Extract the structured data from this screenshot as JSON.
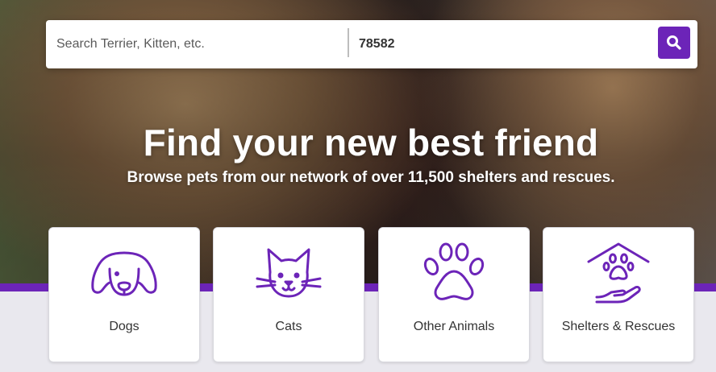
{
  "search": {
    "pet_placeholder": "Search Terrier, Kitten, etc.",
    "location_value": "78582",
    "button_icon": "search-icon"
  },
  "hero": {
    "headline": "Find your new best friend",
    "subheadline": "Browse pets from our network of over 11,500 shelters and rescues."
  },
  "categories": [
    {
      "label": "Dogs",
      "icon": "dog-icon"
    },
    {
      "label": "Cats",
      "icon": "cat-icon"
    },
    {
      "label": "Other Animals",
      "icon": "paw-icon"
    },
    {
      "label": "Shelters & Rescues",
      "icon": "shelter-icon"
    }
  ],
  "colors": {
    "brand_purple": "#6c24b8",
    "page_background": "#e9e8ee",
    "card_background": "#ffffff",
    "text": "#333333"
  }
}
